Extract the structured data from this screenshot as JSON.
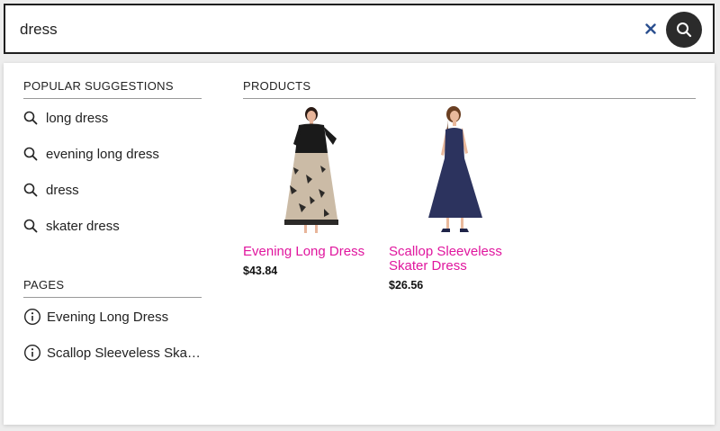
{
  "search": {
    "value": "dress",
    "placeholder": ""
  },
  "sections": {
    "popular_title": "POPULAR SUGGESTIONS",
    "pages_title": "PAGES",
    "products_title": "PRODUCTS"
  },
  "suggestions": [
    "long dress",
    "evening long dress",
    "dress",
    "skater dress"
  ],
  "pages": [
    "Evening Long Dress",
    "Scallop Sleeveless Skater Dress"
  ],
  "products": [
    {
      "name": "Evening Long Dress",
      "price": "$43.84"
    },
    {
      "name": "Scallop Sleeveless Skater Dress",
      "price": "$26.56"
    }
  ],
  "icons": {
    "clear": "close-icon",
    "search": "search-icon",
    "suggestion": "search-icon",
    "page": "info-icon"
  },
  "colors": {
    "product_name": "#e0169e",
    "search_button": "#2b2b2b",
    "clear_icon": "#2a4f8f"
  }
}
